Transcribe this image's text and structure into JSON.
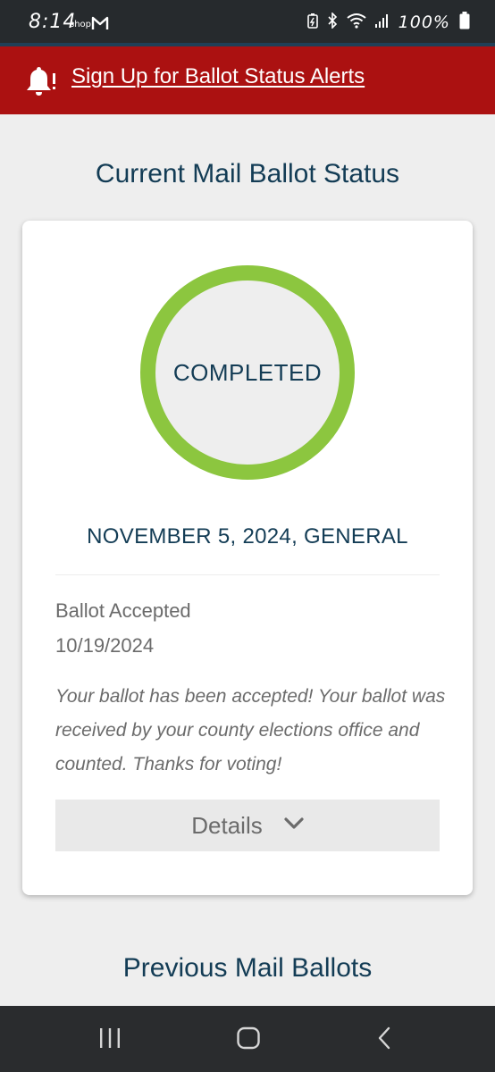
{
  "status_bar": {
    "time": "8:14",
    "shop_label": "shop",
    "battery_text": "100%",
    "icons": [
      "gmail-icon",
      "battery-saver-icon",
      "bluetooth-icon",
      "wifi-icon",
      "signal-icon",
      "battery-icon"
    ]
  },
  "alert_banner": {
    "link_text": "Sign Up for Ballot Status Alerts",
    "icon": "bell-icon",
    "color": "#ab1111"
  },
  "current_section": {
    "title": "Current Mail Ballot Status"
  },
  "ballot_card": {
    "ring_status": "COMPLETED",
    "ring_color": "#8cc63f",
    "ring_progress": 1.0,
    "election_name": "NOVEMBER 5, 2024, GENERAL",
    "status_label": "Ballot Accepted",
    "status_date": "10/19/2024",
    "status_message": "Your ballot has been accepted! Your ballot was received by your county elections office and counted. Thanks for voting!",
    "details_label": "Details",
    "details_icon": "chevron-down-icon"
  },
  "previous_section": {
    "title": "Previous Mail Ballots"
  },
  "nav_bar": {
    "buttons": [
      "recent-apps-icon",
      "home-icon",
      "back-icon"
    ]
  }
}
